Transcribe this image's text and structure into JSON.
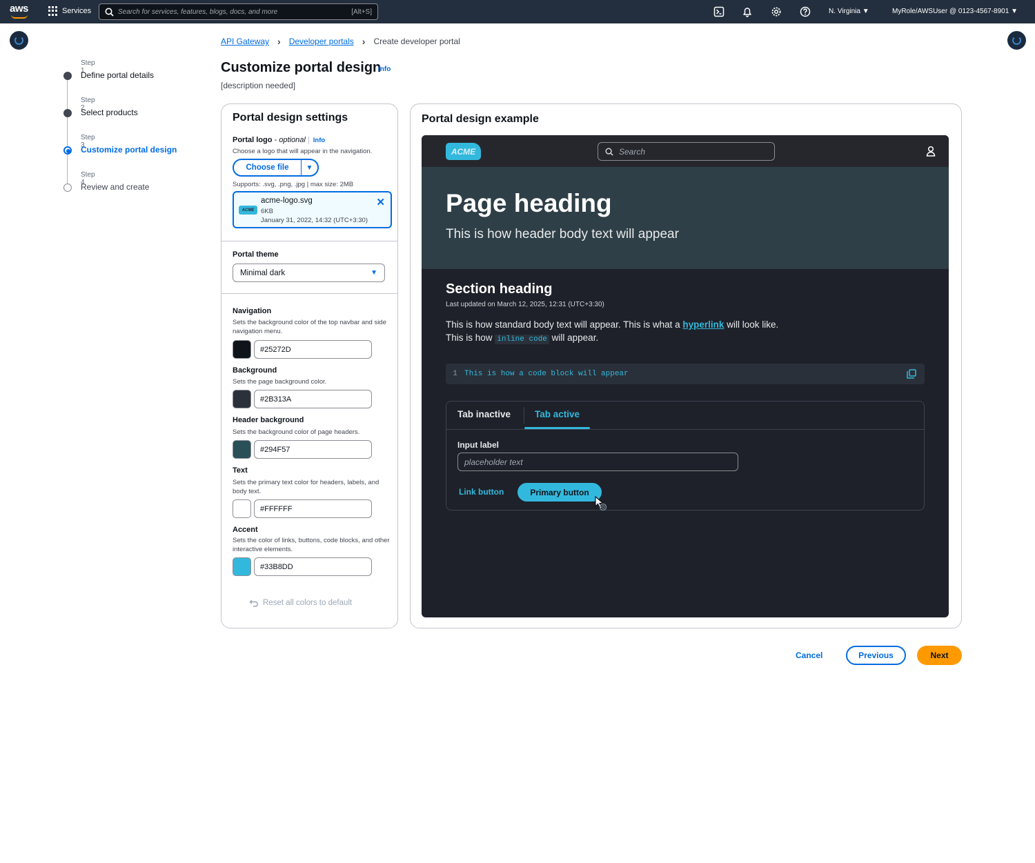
{
  "topnav": {
    "logo_text": "aws",
    "services_label": "Services",
    "search_placeholder": "Search for services, features, blogs, docs, and more",
    "search_shortcut": "[Alt+S]",
    "region": "N. Virginia",
    "account": "MyRole/AWSUser @ 0123-4567-8901",
    "icons": [
      "cloudshell-icon",
      "bell-icon",
      "settings-icon",
      "help-icon"
    ]
  },
  "breadcrumb": {
    "items": [
      "API Gateway",
      "Developer portals"
    ],
    "current": "Create developer portal"
  },
  "steps": [
    {
      "label": "Step 1",
      "name": "Define portal details",
      "state": "complete"
    },
    {
      "label": "Step 2",
      "name": "Select products",
      "state": "complete"
    },
    {
      "label": "Step 3",
      "name": "Customize portal design",
      "state": "active"
    },
    {
      "label": "Step 4",
      "name": "Review and create",
      "state": "pending"
    }
  ],
  "page": {
    "title": "Customize portal design",
    "info": "Info",
    "description": "[description needed]"
  },
  "settings": {
    "title": "Portal design settings",
    "logo": {
      "label": "Portal logo",
      "optional": " - optional",
      "info": "Info",
      "description": "Choose a logo that will appear in the navigation.",
      "button": "Choose file",
      "supports": "Supports: .svg, .png, .jpg | max size: 2MB",
      "file": {
        "thumb": "ACME",
        "name": "acme-logo.svg",
        "size": "6KB",
        "date": "January 31, 2022, 14:32 (UTC+3:30)"
      }
    },
    "theme": {
      "label": "Portal theme",
      "value": "Minimal dark"
    },
    "colors": [
      {
        "label": "Navigation",
        "description": "Sets the background color of the top navbar and side navigation menu.",
        "value": "#25272D"
      },
      {
        "label": "Background",
        "description": "Sets the page background color.",
        "value": "#2B313A"
      },
      {
        "label": "Header background",
        "description": "Sets the background color of page headers.",
        "value": "#294F57"
      },
      {
        "label": "Text",
        "description": "Sets the primary text color for headers, labels, and body text.",
        "value": "#FFFFFF"
      },
      {
        "label": "Accent",
        "description": "Sets the color of links, buttons, code blocks, and other interactive elements.",
        "value": "#33B8DD"
      }
    ],
    "reset": "Reset all colors to default"
  },
  "preview": {
    "title": "Portal design example",
    "logo": "ACME",
    "search_placeholder": "Search",
    "page_heading": "Page heading",
    "header_body": "This is how header body text will appear",
    "section_heading": "Section heading",
    "last_updated": "Last updated on March 12, 2025, 12:31 (UTC+3:30)",
    "body_part1": "This is how standard body text will appear. This is what a ",
    "hyperlink": "hyperlink",
    "body_part2": " will look like.",
    "body_line2_a": "This is how ",
    "inline_code": "inline code",
    "body_line2_b": " will appear.",
    "code_line_number": "1",
    "code_text": "This is how a code block will appear",
    "tab_inactive": "Tab inactive",
    "tab_active": "Tab active",
    "input_label": "Input label",
    "input_placeholder": "placeholder text",
    "link_button": "Link button",
    "primary_button": "Primary button"
  },
  "footer": {
    "cancel": "Cancel",
    "previous": "Previous",
    "next": "Next"
  },
  "colors": {
    "accent": "#006ce0",
    "nav_bg": "#232f3e",
    "next_button": "#ff9900"
  }
}
